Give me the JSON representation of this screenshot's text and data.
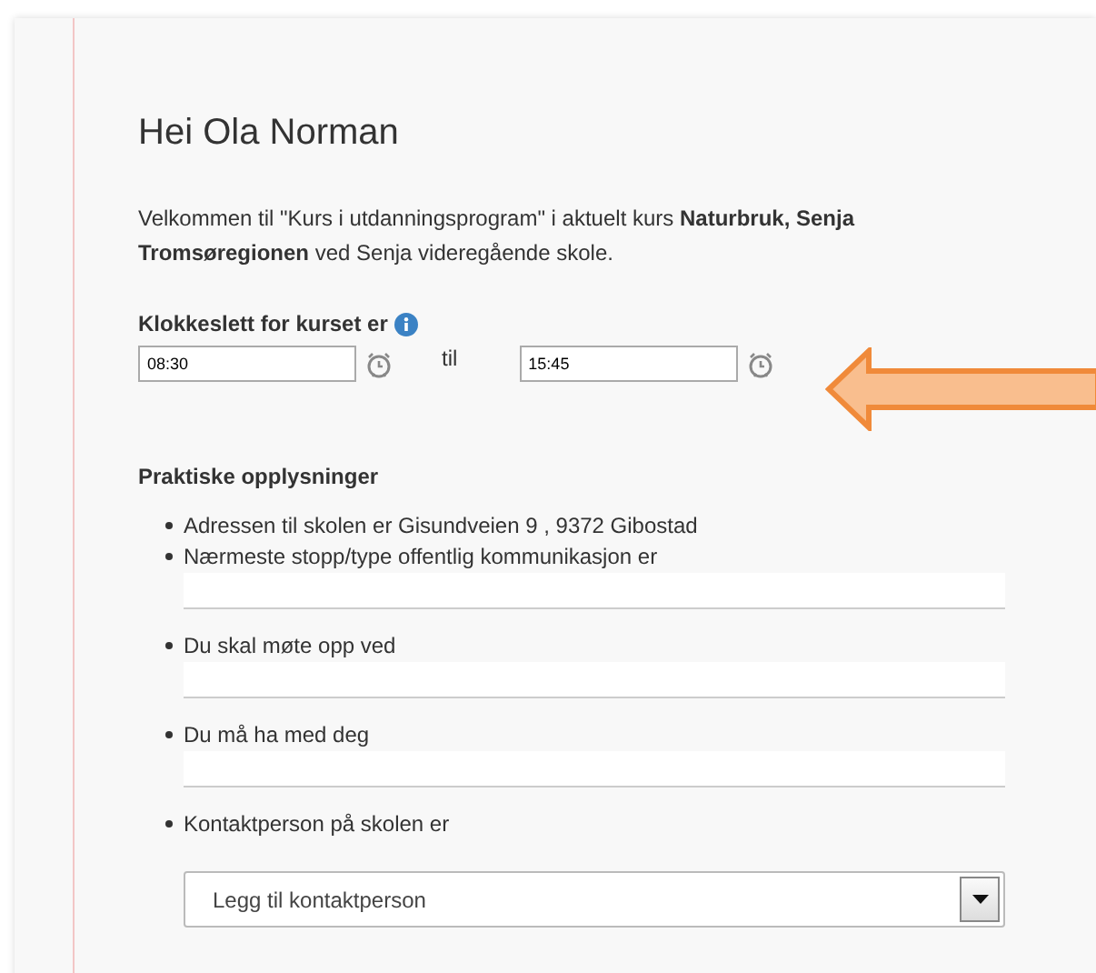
{
  "greeting": "Hei Ola Norman",
  "intro": "Velkommen til \"Kurs i utdanningsprogram\" i aktuelt kurs **Naturbruk, Senja Tromsøregionen** ved Senja videregående skole.",
  "time": {
    "label": "Klokkeslett for kurset er",
    "from": "08:30",
    "separator": "til",
    "to": "15:45"
  },
  "practical": {
    "heading": "Praktiske opplysninger",
    "items": [
      {
        "kind": "text",
        "text": "Adressen til skolen er Gisundveien 9 , 9372 Gibostad"
      },
      {
        "kind": "field",
        "text": "Nærmeste stopp/type offentlig kommunikasjon er"
      },
      {
        "kind": "field",
        "text": "Du skal møte opp ved"
      },
      {
        "kind": "field",
        "text": "Du må ha med deg"
      },
      {
        "kind": "select",
        "text": "Kontaktperson på skolen er",
        "value": "Legg til kontaktperson"
      }
    ]
  }
}
